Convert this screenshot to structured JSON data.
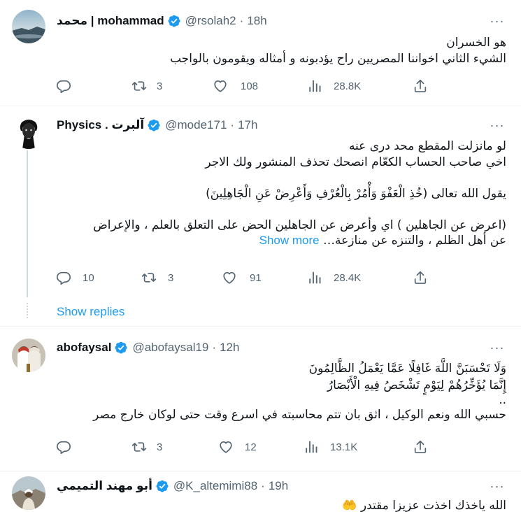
{
  "tweets": [
    {
      "name": "محمد | mohammad",
      "handle": "@rsolah2",
      "separator": "·",
      "time": "18h",
      "lines": [
        "هو الخسران",
        "الشيء الثاني اخواننا المصريين راح يؤدبونه و أمثاله ويقومون بالواجب"
      ],
      "replies": "",
      "retweets": "3",
      "likes": "108",
      "views": "28.8K"
    },
    {
      "name": "Physics . آلبرت",
      "handle": "@mode171",
      "separator": "·",
      "time": "17h",
      "lines": [
        "لو مانزلت المقطع محد درى عنه",
        "اخي صاحب الحساب الكعّام انصحك تحذف المنشور ولك الاجر",
        "",
        "يقول الله تعالى (خُذِ الْعَفْوَ وَأْمُرْ بِالْعُرْفِ وَأَعْرِضْ عَنِ الْجَاهِلِينَ)",
        "",
        "(اعرض عن الجاهلين ) اي وأعرض عن الجاهلين الحض على التعلق بالعلم ، والإعراض",
        "عن أهل الظلم ، والتنزه عن منازعة…"
      ],
      "show_more": "Show more",
      "replies": "10",
      "retweets": "3",
      "likes": "91",
      "views": "28.4K",
      "show_replies": "Show replies"
    },
    {
      "name": "abofaysal",
      "handle": "@abofaysal19",
      "separator": "·",
      "time": "12h",
      "lines": [
        "وَلَا تَحْسَبَنَّ اللَّهَ غَافِلًا عَمَّا يَعْمَلُ الظَّالِمُونَ",
        "إِنَّمَا يُؤَخِّرُهُمْ لِيَوْمٍ تَشْخَصُ فِيهِ الْأَبْصَارُ",
        "..",
        "حسبي الله ونعم الوكيل ، اثق بان تتم محاسبته في اسرع وقت حتى لوكان خارج مصر"
      ],
      "replies": "",
      "retweets": "3",
      "likes": "12",
      "views": "13.1K"
    },
    {
      "name": "أبو مهند التميمي",
      "handle": "@K_altemimi88",
      "separator": "·",
      "time": "19h",
      "lines": [
        "الله ياخذك اخذت عزيزا مقتدر"
      ],
      "emoji": "🤲"
    }
  ],
  "icons": {
    "reply": "reply-icon",
    "retweet": "retweet-icon",
    "like": "heart-icon",
    "views": "views-icon",
    "share": "share-icon",
    "more": "more-options-icon",
    "verified": "verified-badge-icon"
  },
  "colors": {
    "accent": "#1d9bf0",
    "secondary_text": "#536471",
    "divider": "#eff3f4",
    "thread_line": "#cfd9de"
  }
}
